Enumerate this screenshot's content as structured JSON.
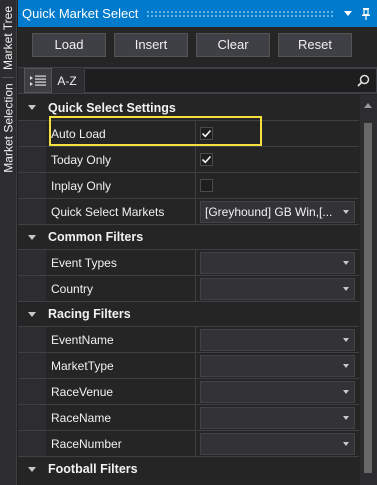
{
  "side_tabs": [
    {
      "label": "Market Tree"
    },
    {
      "label": "Market Selection"
    }
  ],
  "panel": {
    "title": "Quick Market Select",
    "dropdown_icon": "triangle-down-icon",
    "pin_icon": "pin-icon"
  },
  "buttons": {
    "load": "Load",
    "insert": "Insert",
    "clear": "Clear",
    "reset": "Reset"
  },
  "toolbar": {
    "categorized_icon": "categorized-list-icon",
    "alphabetical_label": "A-Z",
    "search_value": "",
    "search_icon": "search-icon"
  },
  "categories": [
    {
      "name": "Quick Select Settings",
      "props": [
        {
          "name": "Auto Load",
          "type": "checkbox",
          "checked": true
        },
        {
          "name": "Today Only",
          "type": "checkbox",
          "checked": true
        },
        {
          "name": "Inplay Only",
          "type": "checkbox",
          "checked": false
        },
        {
          "name": "Quick Select Markets",
          "type": "combo",
          "value": "[Greyhound] GB Win,[..."
        }
      ]
    },
    {
      "name": "Common Filters",
      "props": [
        {
          "name": "Event Types",
          "type": "combo",
          "value": ""
        },
        {
          "name": "Country",
          "type": "combo",
          "value": ""
        }
      ]
    },
    {
      "name": "Racing Filters",
      "props": [
        {
          "name": "EventName",
          "type": "combo",
          "value": ""
        },
        {
          "name": "MarketType",
          "type": "combo",
          "value": ""
        },
        {
          "name": "RaceVenue",
          "type": "combo",
          "value": ""
        },
        {
          "name": "RaceName",
          "type": "combo",
          "value": ""
        },
        {
          "name": "RaceNumber",
          "type": "combo",
          "value": ""
        }
      ]
    },
    {
      "name": "Football Filters",
      "props": []
    }
  ],
  "colors": {
    "accent": "#007acc",
    "highlight": "#f5e042"
  }
}
